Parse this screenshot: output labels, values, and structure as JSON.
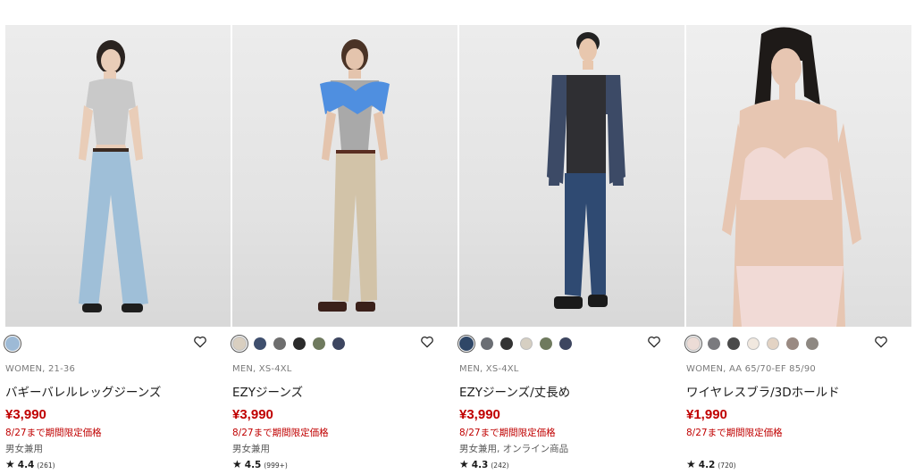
{
  "products": [
    {
      "swatches": [
        "#9dbad6"
      ],
      "selected": 0,
      "meta": "WOMEN, 21-36",
      "name": "バギーバレルレッグジーンズ",
      "price": "¥3,990",
      "promo": "8/27まで期間限定価格",
      "tag": "男女兼用",
      "rating": "4.4",
      "count": "(261)"
    },
    {
      "swatches": [
        "#d9cfc0",
        "#3f4f6e",
        "#6e6e6e",
        "#2b2b2b",
        "#6f7a5e",
        "#3d4660"
      ],
      "selected": 0,
      "meta": "MEN, XS-4XL",
      "name": "EZYジーンズ",
      "price": "¥3,990",
      "promo": "8/27まで期間限定価格",
      "tag": "男女兼用",
      "rating": "4.5",
      "count": "(999+)"
    },
    {
      "swatches": [
        "#2f4767",
        "#6b6e74",
        "#333333",
        "#d6cfc2",
        "#6f7a5e",
        "#3d4660"
      ],
      "selected": 0,
      "meta": "MEN, XS-4XL",
      "name": "EZYジーンズ/丈長め",
      "price": "¥3,990",
      "promo": "8/27まで期間限定価格",
      "tag": "男女兼用, オンライン商品",
      "rating": "4.3",
      "count": "(242)"
    },
    {
      "swatches": [
        "#ecdcd6",
        "#7a7a7e",
        "#4a4a4a",
        "#f1e8df",
        "#e3d3c4",
        "#9a8a82",
        "#8e8882"
      ],
      "selected": 0,
      "meta": "WOMEN, AA 65/70-EF 85/90",
      "name": "ワイヤレスブラ/3Dホールド",
      "price": "¥1,990",
      "promo": "8/27まで期間限定価格",
      "tag": "",
      "rating": "4.2",
      "count": "(720)"
    }
  ],
  "icons": {
    "favorite": "heart-outline-icon",
    "star": "star-icon"
  }
}
